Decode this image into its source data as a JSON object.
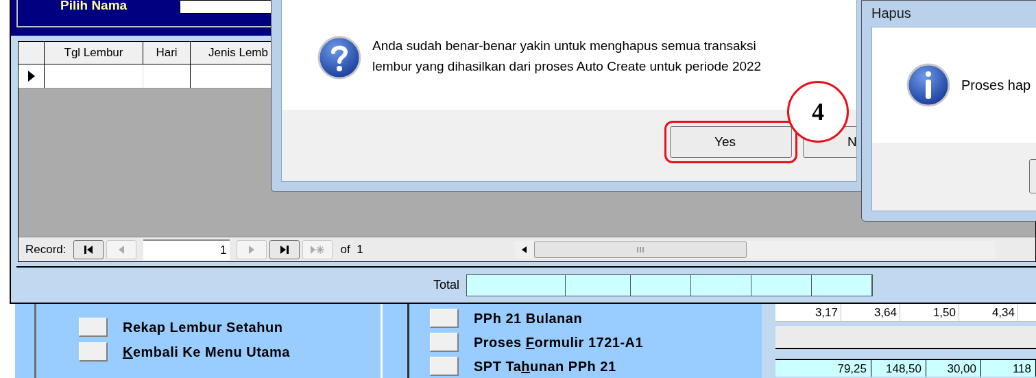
{
  "form": {
    "name_label": "Pilih Nama",
    "grid_columns": [
      "Tgl Lembur",
      "Hari",
      "Jenis Lemb"
    ],
    "record_nav": {
      "label": "Record:",
      "current": "1",
      "of_text": "of  1"
    },
    "total_label": "Total"
  },
  "menu_left": [
    {
      "label": "Rekap Lembur Setahun"
    },
    {
      "access_key": "K",
      "label_after": "embali Ke Menu Utama"
    }
  ],
  "menu_middle": [
    {
      "label": "PPh 21 Bulanan"
    },
    {
      "label_before": "Proses ",
      "access_key": "F",
      "label_after": "ormulir 1721-A1"
    },
    {
      "label_before": "SPT Ta",
      "access_key": "h",
      "label_after": "unan PPh 21"
    }
  ],
  "summary_table": {
    "row": [
      "3,17",
      "3,64",
      "1,50",
      "4,34"
    ],
    "totals": [
      "79,25",
      "148,50",
      "30,00",
      "118"
    ]
  },
  "confirm_dialog": {
    "message_lines": [
      "Anda sudah benar-benar yakin untuk menghapus semua transaksi",
      "lembur yang dihasilkan dari proses Auto Create untuk periode 2022"
    ],
    "buttons": [
      {
        "label": "Yes",
        "highlighted": true
      },
      {
        "label": "N",
        "highlighted": false
      }
    ],
    "callout": "4"
  },
  "info_dialog": {
    "title": "Hapus",
    "message": "Proses hap"
  }
}
